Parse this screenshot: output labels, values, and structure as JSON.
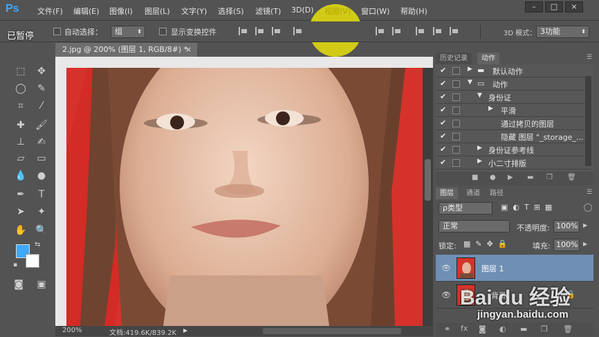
{
  "app": {
    "logo": "Ps"
  },
  "menu": [
    "文件(F)",
    "编辑(E)",
    "图像(I)",
    "图层(L)",
    "文字(Y)",
    "选择(S)",
    "滤镜(T)",
    "3D(D)",
    "视图(V)",
    "窗口(W)",
    "帮助(H)"
  ],
  "window_buttons": [
    "–",
    "□",
    "×"
  ],
  "overlay": {
    "paused": "已暂停"
  },
  "options": {
    "auto_select_label": "自动选择：",
    "auto_select_value": "组",
    "show_transform_label": "显示变换控件",
    "mode_3d_label": "3D 模式：",
    "mode_3d_value": "3功能"
  },
  "document": {
    "tab_title": "2.jpg @ 200% (图层 1, RGB/8#) *",
    "zoom": "200%",
    "doc_size": "文档:419.6K/839.2K"
  },
  "panels": {
    "actions_tabs": [
      "历史记录",
      "动作"
    ],
    "actions": [
      {
        "label": "默认动作",
        "checked": true,
        "arrow": "▶",
        "folder": true
      },
      {
        "label": "动作",
        "checked": true,
        "arrow": "▼",
        "folder": true
      },
      {
        "label": "身份证",
        "checked": true,
        "arrow": "▼",
        "folder": false
      },
      {
        "label": "平滑",
        "checked": true,
        "arrow": "▶",
        "folder": false
      },
      {
        "label": "通过拷贝的图层",
        "checked": true,
        "arrow": "",
        "folder": false
      },
      {
        "label": "隐藏 图层 \"_storage_...",
        "checked": true,
        "arrow": "",
        "folder": false
      },
      {
        "label": "身份证参考线",
        "checked": true,
        "arrow": "▶",
        "folder": false
      },
      {
        "label": "小二寸排版",
        "checked": true,
        "arrow": "▶",
        "folder": false
      }
    ],
    "layers_tabs": [
      "图层",
      "通道",
      "路径"
    ],
    "layer_filter": "ρ类型",
    "blend_mode": "正常",
    "opacity_label": "不透明度:",
    "opacity_value": "100%",
    "lock_label": "锁定:",
    "fill_label": "填充:",
    "fill_value": "100%",
    "layers": [
      {
        "name": "图层 1",
        "selected": true
      },
      {
        "name": "背景",
        "selected": false
      }
    ]
  },
  "watermark": {
    "brand": "Bai du 经验",
    "url": "jingyan.baidu.com"
  },
  "colors": {
    "bg": "#535353",
    "accent": "#3fa8ff",
    "selected_layer": "#6f8fb5",
    "photo_bg": "#d6322c",
    "highlight": "#dcd614"
  }
}
